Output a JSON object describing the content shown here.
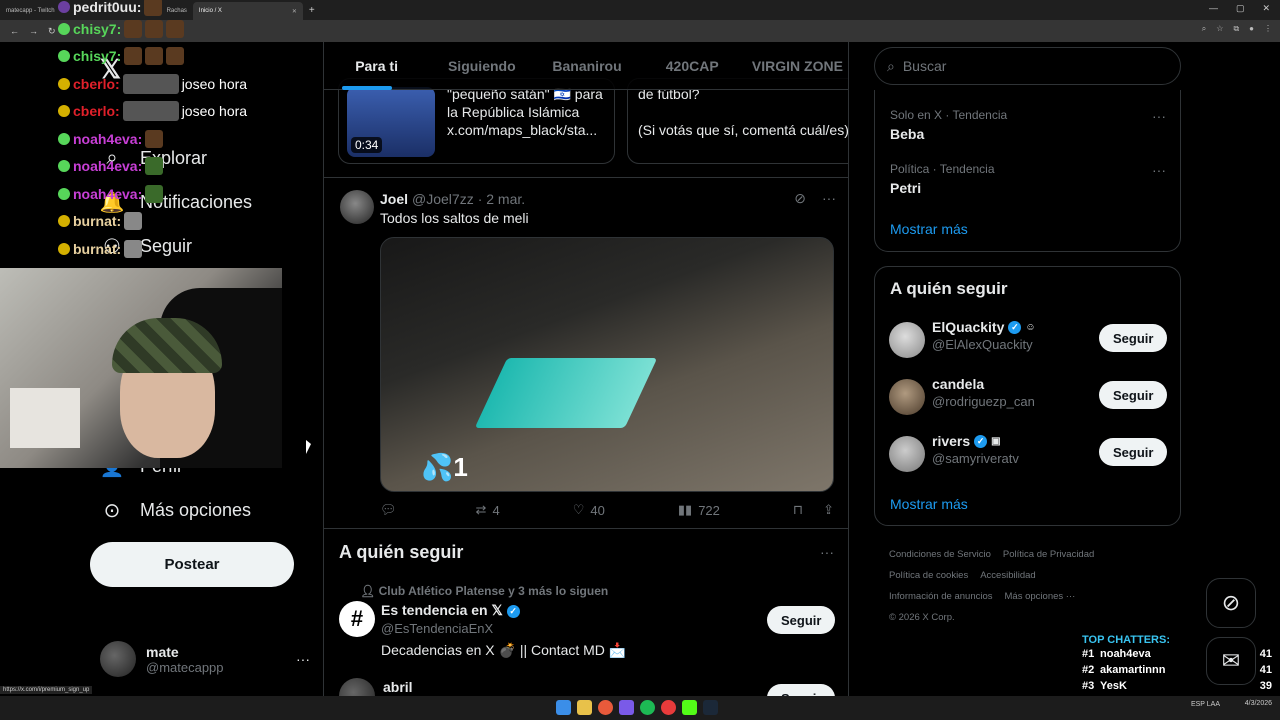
{
  "browser": {
    "tabs": [
      {
        "label": "matecapp - Twitch"
      },
      {
        "label": "Rachas"
      },
      {
        "label": "Inicio / X"
      }
    ],
    "new_tab": "+"
  },
  "left_nav": {
    "items": [
      {
        "label": "Explorar",
        "icon": "search-icon"
      },
      {
        "label": "Notificaciones",
        "icon": "bell-icon"
      },
      {
        "label": "Seguir",
        "icon": "follow-icon"
      },
      {
        "label": "Perfil",
        "icon": "profile-icon"
      },
      {
        "label": "Más opciones",
        "icon": "more-options-icon"
      }
    ],
    "post_button": "Postear",
    "account": {
      "name": "mate",
      "handle": "@matecappp",
      "more": "···"
    }
  },
  "stream_chat": [
    {
      "user": "pedrit0uu:",
      "color": "#e8e8e8",
      "msg": ""
    },
    {
      "user": "chisy7:",
      "color": "#57d65a",
      "msg": ""
    },
    {
      "user": "chisy7:",
      "color": "#57d65a",
      "msg": ""
    },
    {
      "user": "cberlo:",
      "color": "#e0202a",
      "msg": "joseo hora"
    },
    {
      "user": "cberlo:",
      "color": "#e0202a",
      "msg": "joseo hora"
    },
    {
      "user": "noah4eva:",
      "color": "#c83fd6",
      "msg": ""
    },
    {
      "user": "noah4eva:",
      "color": "#c83fd6",
      "msg": ""
    },
    {
      "user": "noah4eva:",
      "color": "#c83fd6",
      "msg": ""
    },
    {
      "user": "burnat:",
      "color": "#e8d1a0",
      "msg": ""
    },
    {
      "user": "burnat:",
      "color": "#e8d1a0",
      "msg": ""
    }
  ],
  "feed_tabs": [
    {
      "label": "Para ti",
      "active": true
    },
    {
      "label": "Siguiendo",
      "active": false
    },
    {
      "label": "Bananirou",
      "active": false
    },
    {
      "label": "420CAP",
      "active": false
    },
    {
      "label": "VIRGIN ZONE",
      "active": false
    }
  ],
  "quote_cards": [
    {
      "duration": "0:34",
      "lines": [
        "\"pequeño satán\" 🇮🇱 para",
        "la República Islámica",
        "x.com/maps_black/sta..."
      ]
    },
    {
      "lines": [
        "de fútbol?",
        "",
        "(Si votás que sí, comentá cuál/es)"
      ]
    }
  ],
  "tweet": {
    "name": "Joel",
    "handle": "@Joel7zz",
    "date": "· 2 mar.",
    "text": "Todos los saltos de meli",
    "media_badge": "💦1",
    "replies": "",
    "retweets": "4",
    "likes": "40",
    "views": "722"
  },
  "who_to_follow_main": {
    "title": "A quién seguir",
    "social_context": "Club Atlético Platense y 3 más lo siguen",
    "suggestion": {
      "name": "Es tendencia en 𝕏",
      "handle": "@EsTendenciaEnX",
      "bio": "Decadencias en X 💣 || Contact MD 📩",
      "button": "Seguir"
    },
    "next": {
      "name": "abril",
      "button": "Seguir"
    }
  },
  "right": {
    "search_placeholder": "Buscar",
    "trends": [
      {
        "category": "Solo en X · Tendencia",
        "name": "Beba"
      },
      {
        "category": "Política · Tendencia",
        "name": "Petri"
      }
    ],
    "trends_show_more": "Mostrar más",
    "who_title": "A quién seguir",
    "who": [
      {
        "name": "ElQuackity",
        "handle": "@ElAlexQuackity",
        "button": "Seguir",
        "verified": true
      },
      {
        "name": "candela",
        "handle": "@rodriguezp_can",
        "button": "Seguir",
        "verified": false
      },
      {
        "name": "rivers",
        "handle": "@samyriveratv",
        "button": "Seguir",
        "verified": true
      }
    ],
    "who_show_more": "Mostrar más",
    "footer": [
      "Condiciones de Servicio",
      "Política de Privacidad",
      "Política de cookies",
      "Accesibilidad",
      "Información de anuncios",
      "Más opciones ···",
      "© 2026 X Corp."
    ]
  },
  "top_chatters": {
    "title": "TOP CHATTERS:",
    "rows": [
      {
        "rank": "#1",
        "name": "noah4eva",
        "count": "41"
      },
      {
        "rank": "#2",
        "name": "akamartinnn",
        "count": "41"
      },
      {
        "rank": "#3",
        "name": "YesK",
        "count": "39"
      }
    ]
  },
  "status_url": "https://x.com/i/premium_sign_up",
  "taskbar": {
    "lang": "ESP LAA",
    "date": "4/3/2026"
  },
  "colors": {
    "accent": "#1d9bf0",
    "background": "#000000",
    "border": "#2f3336"
  }
}
